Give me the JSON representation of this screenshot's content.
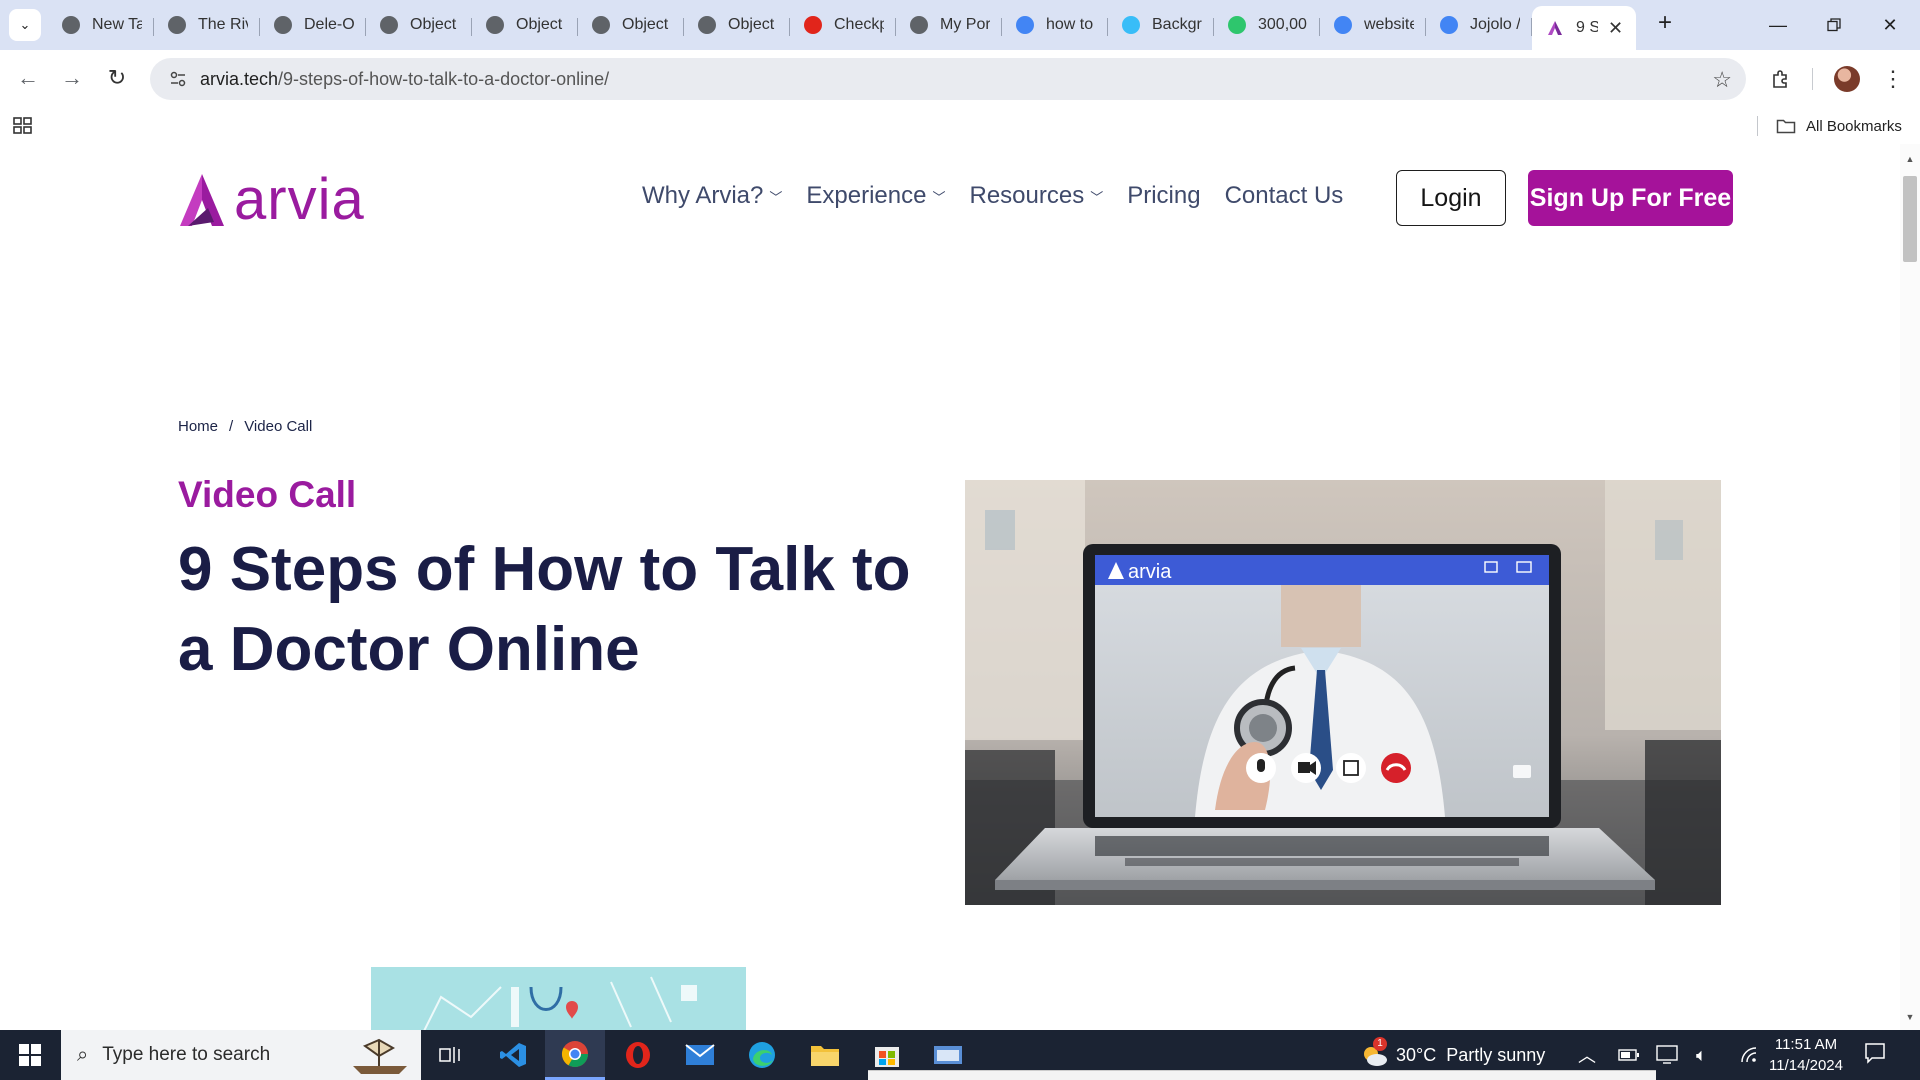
{
  "browser": {
    "tabs": [
      {
        "title": "New Ta",
        "favicon": "chrome-icon",
        "color": "#5f6368"
      },
      {
        "title": "The Riv",
        "favicon": "globe-icon",
        "color": "#5f6368"
      },
      {
        "title": "Dele-O",
        "favicon": "globe-icon",
        "color": "#5f6368"
      },
      {
        "title": "Object",
        "favicon": "globe-icon",
        "color": "#5f6368"
      },
      {
        "title": "Object",
        "favicon": "globe-icon",
        "color": "#5f6368"
      },
      {
        "title": "Object",
        "favicon": "globe-icon",
        "color": "#5f6368"
      },
      {
        "title": "Object",
        "favicon": "globe-icon",
        "color": "#5f6368"
      },
      {
        "title": "Checkp",
        "favicon": "opera-icon",
        "color": "#e1251b"
      },
      {
        "title": "My Por",
        "favicon": "globe-icon",
        "color": "#5f6368"
      },
      {
        "title": "how to",
        "favicon": "google-icon",
        "color": "#4285f4"
      },
      {
        "title": "Backgr",
        "favicon": "tailwind-icon",
        "color": "#38bdf8"
      },
      {
        "title": "300,00",
        "favicon": "pixabay-icon",
        "color": "#2ec66d"
      },
      {
        "title": "website",
        "favicon": "google-icon",
        "color": "#4285f4"
      },
      {
        "title": "Jojolo /",
        "favicon": "google-icon",
        "color": "#4285f4"
      }
    ],
    "active_tab": {
      "title": "9 S",
      "favicon": "arvia-icon"
    },
    "url_domain": "arvia.tech",
    "url_path": "/9-steps-of-how-to-talk-to-a-doctor-online/",
    "bookmarks_label": "All Bookmarks"
  },
  "site": {
    "logo_text": "arvia",
    "brand_color": "#9a1b9f",
    "nav": [
      {
        "label": "Why Arvia?",
        "dropdown": true
      },
      {
        "label": "Experience",
        "dropdown": true
      },
      {
        "label": "Resources",
        "dropdown": true
      },
      {
        "label": "Pricing",
        "dropdown": false
      },
      {
        "label": "Contact Us",
        "dropdown": false
      }
    ],
    "login_label": "Login",
    "signup_label": "Sign Up For Free"
  },
  "article": {
    "breadcrumb_home": "Home",
    "breadcrumb_sep": "/",
    "breadcrumb_current": "Video Call",
    "category": "Video Call",
    "title": "9 Steps of How to Talk to a Doctor Online",
    "hero_screen_logo": "arvia"
  },
  "taskbar": {
    "search_placeholder": "Type here to search",
    "weather": "30°C  Partly sunny",
    "weather_badge": "1",
    "time": "11:51 AM",
    "date": "11/14/2024"
  }
}
